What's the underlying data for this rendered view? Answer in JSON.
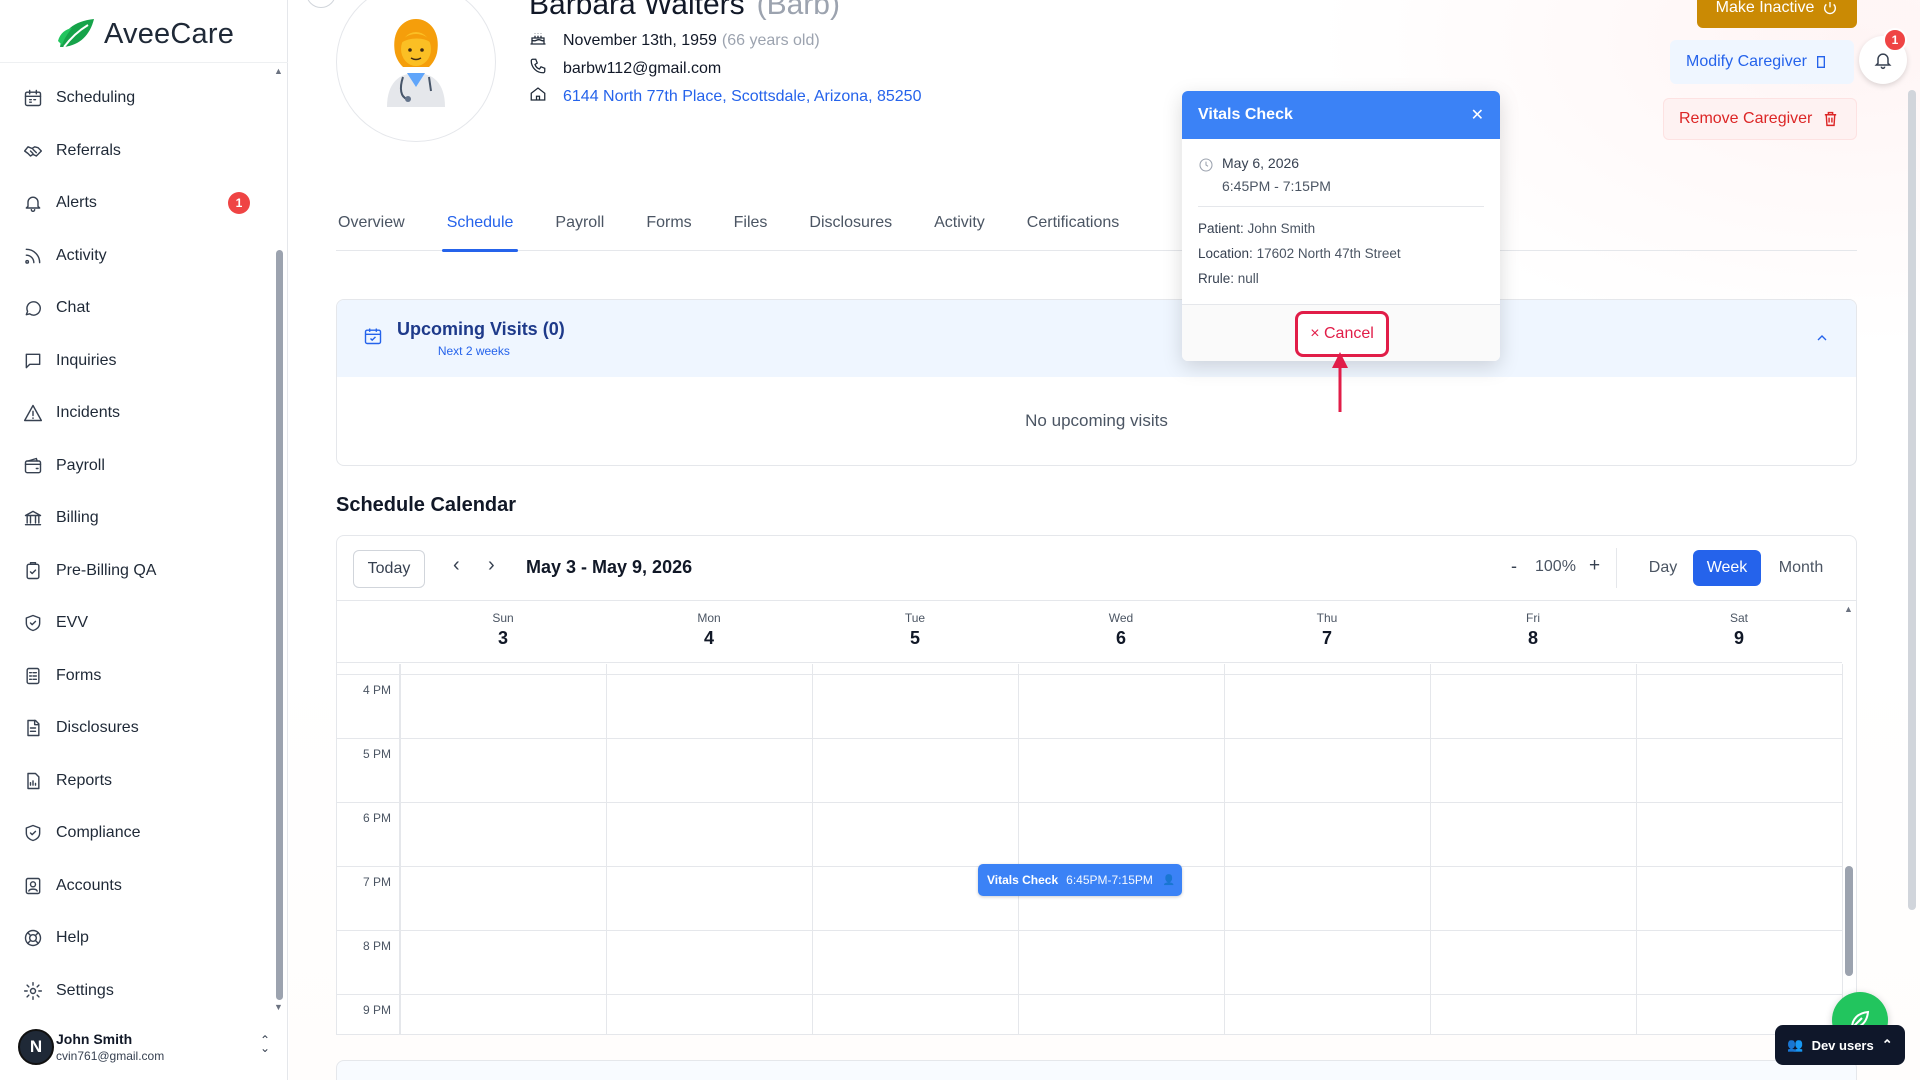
{
  "app": {
    "name": "AveeCare"
  },
  "sidebar": {
    "items": [
      {
        "label": "Scheduling",
        "icon": "calendar-icon"
      },
      {
        "label": "Referrals",
        "icon": "handshake-icon"
      },
      {
        "label": "Alerts",
        "icon": "bell-icon",
        "badge": "1"
      },
      {
        "label": "Activity",
        "icon": "rss-icon"
      },
      {
        "label": "Chat",
        "icon": "chat-icon"
      },
      {
        "label": "Inquiries",
        "icon": "message-square-icon"
      },
      {
        "label": "Incidents",
        "icon": "warning-icon"
      },
      {
        "label": "Payroll",
        "icon": "wallet-icon"
      },
      {
        "label": "Billing",
        "icon": "bank-icon"
      },
      {
        "label": "Pre-Billing QA",
        "icon": "clipboard-check-icon"
      },
      {
        "label": "EVV",
        "icon": "shield-check-icon"
      },
      {
        "label": "Forms",
        "icon": "form-icon"
      },
      {
        "label": "Disclosures",
        "icon": "document-icon"
      },
      {
        "label": "Reports",
        "icon": "report-icon"
      },
      {
        "label": "Compliance",
        "icon": "shield-check-icon"
      },
      {
        "label": "Accounts",
        "icon": "contact-icon"
      },
      {
        "label": "Help",
        "icon": "lifebuoy-icon"
      },
      {
        "label": "Settings",
        "icon": "gear-icon"
      }
    ],
    "user": {
      "initial": "N",
      "name": "John Smith",
      "email": "cvin761@gmail.com"
    }
  },
  "profile": {
    "name": "Barbara Walters",
    "nickname": "(Barb)",
    "dob": "November 13th, 1959",
    "age": "(66 years old)",
    "email": "barbw112@gmail.com",
    "address": "6144 North 77th Place, Scottsdale, Arizona, 85250"
  },
  "actions": {
    "make_inactive": "Make Inactive",
    "modify": "Modify Caregiver",
    "remove": "Remove Caregiver",
    "notifications_badge": "1"
  },
  "tabs": [
    {
      "label": "Overview"
    },
    {
      "label": "Schedule",
      "active": true
    },
    {
      "label": "Payroll"
    },
    {
      "label": "Forms"
    },
    {
      "label": "Files"
    },
    {
      "label": "Disclosures"
    },
    {
      "label": "Activity"
    },
    {
      "label": "Certifications"
    }
  ],
  "upcoming": {
    "title": "Upcoming Visits (0)",
    "subtitle": "Next 2 weeks",
    "empty": "No upcoming visits"
  },
  "calendar": {
    "section_title": "Schedule Calendar",
    "today": "Today",
    "range": "May 3 - May 9, 2026",
    "zoom_minus": "-",
    "zoom": "100%",
    "zoom_plus": "+",
    "views": {
      "day": "Day",
      "week": "Week",
      "month": "Month"
    },
    "days": [
      {
        "name": "Sun",
        "date": "3"
      },
      {
        "name": "Mon",
        "date": "4"
      },
      {
        "name": "Tue",
        "date": "5"
      },
      {
        "name": "Wed",
        "date": "6"
      },
      {
        "name": "Thu",
        "date": "7"
      },
      {
        "name": "Fri",
        "date": "8"
      },
      {
        "name": "Sat",
        "date": "9"
      }
    ],
    "hours": [
      "4 PM",
      "5 PM",
      "6 PM",
      "7 PM",
      "8 PM",
      "9 PM"
    ],
    "event": {
      "title": "Vitals Check",
      "time": "6:45PM-7:15PM",
      "day": "Wed"
    }
  },
  "popup": {
    "title": "Vitals Check",
    "date": "May 6, 2026",
    "time": "6:45PM - 7:15PM",
    "patient_label": "Patient:",
    "patient": "John Smith",
    "location_label": "Location:",
    "location": "17602 North 47th Street",
    "rrule_label": "Rrule:",
    "rrule": "null",
    "cancel": "× Cancel"
  },
  "dev": {
    "label": "Dev users"
  },
  "colors": {
    "primary": "#2563eb",
    "event": "#3b82f6",
    "warning": "#ca8a04",
    "danger": "#dc2626",
    "annotation": "#e11d48"
  }
}
